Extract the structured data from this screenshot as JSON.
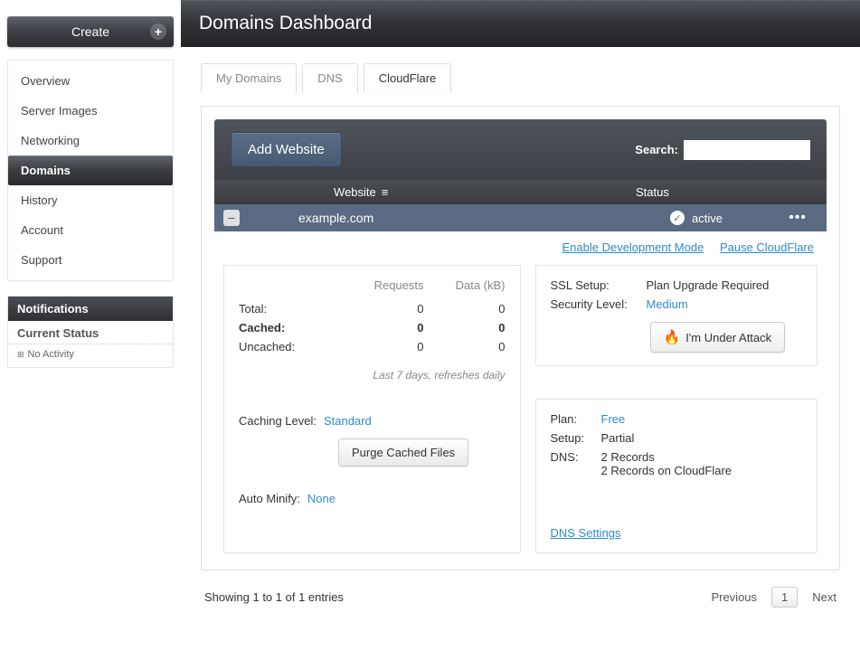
{
  "sidebar": {
    "create_label": "Create",
    "nav": [
      "Overview",
      "Server Images",
      "Networking",
      "Domains",
      "History",
      "Account",
      "Support"
    ],
    "nav_active_index": 3,
    "notifications_title": "Notifications",
    "notifications_subhead": "Current Status",
    "notifications_row": "No Activity"
  },
  "header": {
    "title": "Domains Dashboard"
  },
  "tabs": {
    "items": [
      "My Domains",
      "DNS",
      "CloudFlare"
    ],
    "active_index": 2
  },
  "toolbar": {
    "add_website_label": "Add Website",
    "search_label": "Search:",
    "search_value": ""
  },
  "columns": {
    "website": "Website",
    "status": "Status"
  },
  "site_row": {
    "toggle_glyph": "−",
    "name": "example.com",
    "status": "active"
  },
  "actions": {
    "enable_dev_mode": "Enable Development Mode",
    "pause_cloudflare": "Pause CloudFlare"
  },
  "stats": {
    "col_requests": "Requests",
    "col_data": "Data (kB)",
    "rows": [
      {
        "label": "Total:",
        "requests": "0",
        "data": "0",
        "bold": false
      },
      {
        "label": "Cached:",
        "requests": "0",
        "data": "0",
        "bold": true
      },
      {
        "label": "Uncached:",
        "requests": "0",
        "data": "0",
        "bold": false
      }
    ],
    "note": "Last 7 days, refreshes daily",
    "caching_level_label": "Caching Level:",
    "caching_level_value": "Standard",
    "purge_button": "Purge Cached Files",
    "auto_minify_label": "Auto Minify:",
    "auto_minify_value": "None"
  },
  "security": {
    "ssl_setup_label": "SSL Setup:",
    "ssl_setup_value": "Plan Upgrade Required",
    "security_level_label": "Security Level:",
    "security_level_value": "Medium",
    "attack_button": "I'm Under Attack"
  },
  "plan_card": {
    "plan_label": "Plan:",
    "plan_value": "Free",
    "setup_label": "Setup:",
    "setup_value": "Partial",
    "dns_label": "DNS:",
    "dns_value_line1": "2 Records",
    "dns_value_line2": "2 Records on CloudFlare",
    "dns_settings_link": "DNS Settings"
  },
  "pager": {
    "showing": "Showing 1 to 1 of 1 entries",
    "previous": "Previous",
    "page": "1",
    "next": "Next"
  }
}
